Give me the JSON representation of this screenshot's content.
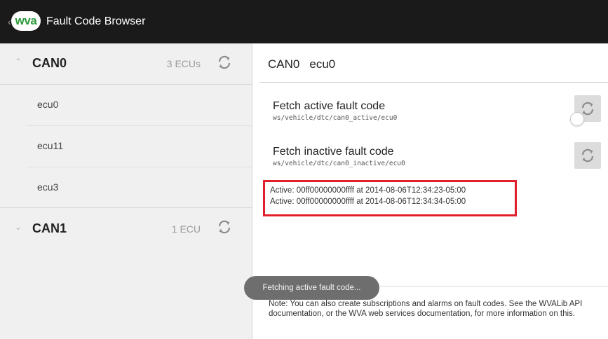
{
  "app": {
    "logo_text": "wva",
    "title": "Fault Code Browser"
  },
  "sidebar": {
    "groups": [
      {
        "name": "CAN0",
        "count": "3 ECUs",
        "expanded": true,
        "children": [
          "ecu0",
          "ecu11",
          "ecu3"
        ]
      },
      {
        "name": "CAN1",
        "count": "1 ECU",
        "expanded": false,
        "children": []
      }
    ]
  },
  "detail": {
    "bus": "CAN0",
    "ecu": "ecu0",
    "active": {
      "title": "Fetch active fault code",
      "path": "ws/vehicle/dtc/can0_active/ecu0"
    },
    "inactive": {
      "title": "Fetch inactive fault code",
      "path": "ws/vehicle/dtc/can0_inactive/ecu0"
    },
    "results": [
      "Active: 00ff00000000ffff at 2014-08-06T12:34:23-05:00",
      "Active: 00ff00000000ffff at 2014-08-06T12:34:34-05:00"
    ],
    "note": "Note: You can also create subscriptions and alarms on fault codes. See the WVALib API documentation, or the WVA web services documentation, for more information on this."
  },
  "toast": "Fetching active fault code...",
  "colors": {
    "action_bar": "#1a1a1a",
    "logo_text": "#2e9a3e",
    "highlight_box": "#e0202a"
  }
}
